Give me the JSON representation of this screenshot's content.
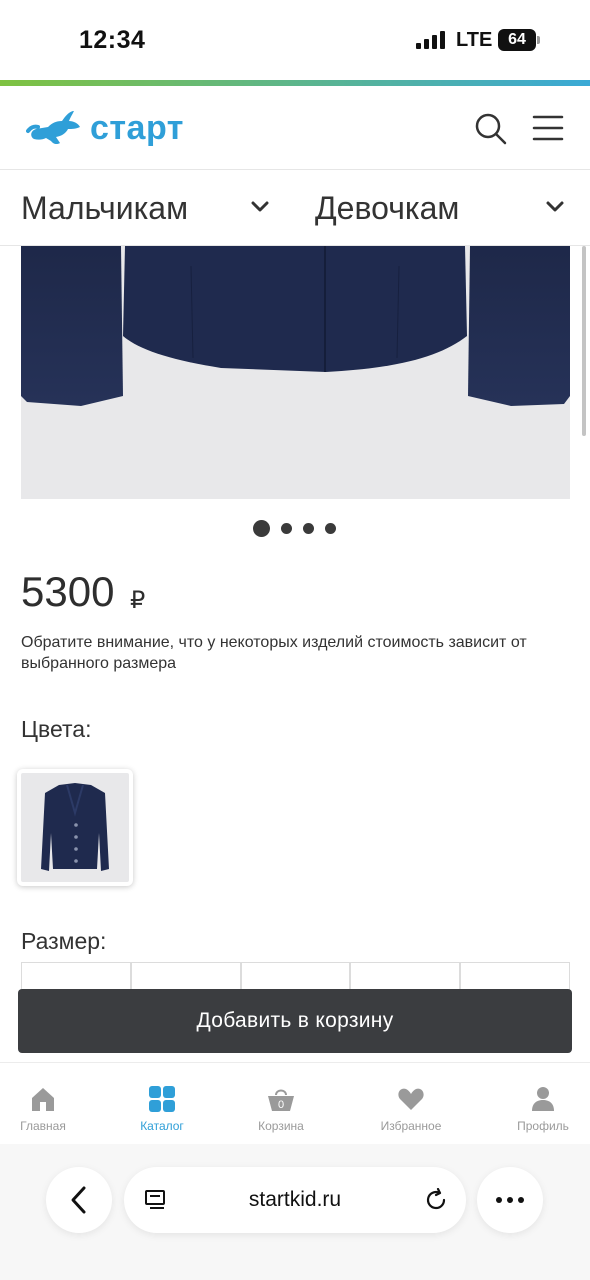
{
  "status_bar": {
    "time": "12:34",
    "network": "LTE",
    "battery": "64"
  },
  "header": {
    "logo_text": "старт",
    "brand_color": "#2f9fd8",
    "icons": [
      "rabbit-logo-icon",
      "search-icon",
      "hamburger-menu-icon"
    ]
  },
  "categories": [
    {
      "label": "Мальчикам"
    },
    {
      "label": "Девочкам"
    }
  ],
  "gallery": {
    "total_slides": 4,
    "active_slide": 1
  },
  "product": {
    "price": "5300",
    "currency": "₽",
    "notice": "Обратите внимание, что у некоторых изделий стоимость зависит от выбранного размера",
    "colors_label": "Цвета:",
    "size_label": "Размер:"
  },
  "actions": {
    "add_to_cart": "Добавить в корзину"
  },
  "bottom_nav": [
    {
      "label": "Главная",
      "icon": "home-icon",
      "active": false
    },
    {
      "label": "Каталог",
      "icon": "catalog-grid-icon",
      "active": true
    },
    {
      "label": "Корзина",
      "icon": "basket-icon",
      "active": false,
      "badge": "0"
    },
    {
      "label": "Избранное",
      "icon": "heart-icon",
      "active": false
    },
    {
      "label": "Профиль",
      "icon": "profile-icon",
      "active": false
    }
  ],
  "browser": {
    "url": "startkid.ru"
  },
  "colors": {
    "accent": "#2f9fd8",
    "button_dark": "#3b3d40",
    "jacket_navy": "#1f2a4d"
  }
}
